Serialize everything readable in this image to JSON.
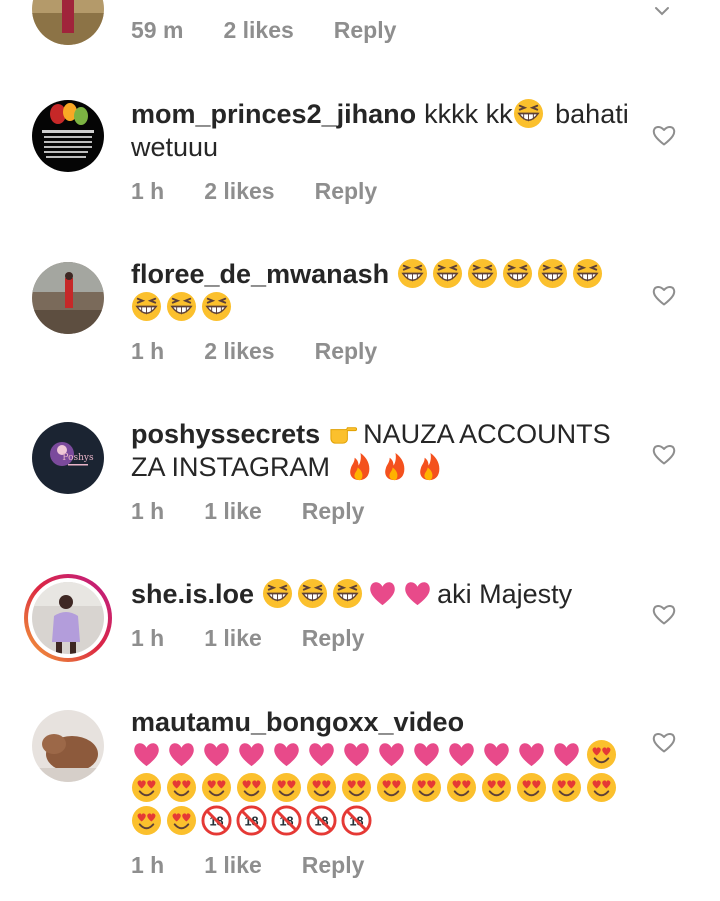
{
  "comments": [
    {
      "username": "",
      "text": "",
      "time": "59 m",
      "likes": "2 likes",
      "reply": "Reply"
    },
    {
      "username": "mom_princes2_jihano",
      "text_before": "kkkk kk",
      "text_after": "bahati wetuuu",
      "emojis": [
        "grinning-squinting-face"
      ],
      "time": "1 h",
      "likes": "2 likes",
      "reply": "Reply"
    },
    {
      "username": "floree_de_mwanash",
      "emojis": [
        "grinning-squinting-face",
        "grinning-squinting-face",
        "grinning-squinting-face",
        "grinning-squinting-face",
        "grinning-squinting-face",
        "grinning-squinting-face",
        "grinning-squinting-face",
        "grinning-squinting-face",
        "grinning-squinting-face"
      ],
      "time": "1 h",
      "likes": "2 likes",
      "reply": "Reply"
    },
    {
      "username": "poshyssecrets",
      "text": "NAUZA ACCOUNTS ZA INSTAGRAM",
      "emojis_lead": [
        "backhand-pointing-right"
      ],
      "emojis_trail": [
        "fire",
        "fire",
        "fire"
      ],
      "time": "1 h",
      "likes": "1 like",
      "reply": "Reply"
    },
    {
      "username": "she.is.loe",
      "text": "aki Majesty",
      "emojis": [
        "grinning-squinting-face",
        "grinning-squinting-face",
        "grinning-squinting-face",
        "heart",
        "heart"
      ],
      "time": "1 h",
      "likes": "1 like",
      "reply": "Reply"
    },
    {
      "username": "mautamu_bongoxx_video",
      "emojis_summary": "13 hearts, 16 heart-eyes faces, 5 no-under-18 symbols",
      "time": "1 h",
      "likes": "1 like",
      "reply": "Reply"
    }
  ],
  "colors": {
    "meta_gray": "#8e8e8e",
    "heart_pink": "#e84a8a",
    "emoji_yellow": "#fbc02d",
    "story_ring": "#dc2743"
  },
  "icons": {
    "like": "heart-outline-icon"
  }
}
